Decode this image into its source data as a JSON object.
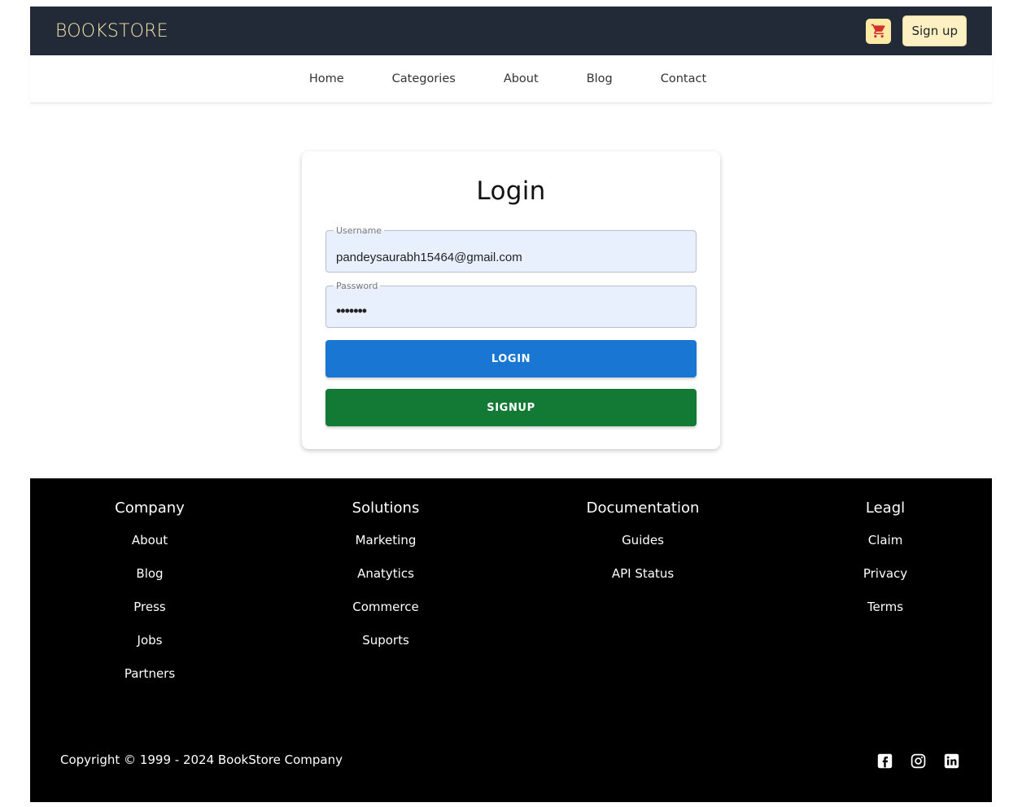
{
  "header": {
    "brand": "BOOKSTORE",
    "cart_icon": "cart-icon",
    "signup_label": "Sign up"
  },
  "nav": {
    "items": [
      "Home",
      "Categories",
      "About",
      "Blog",
      "Contact"
    ]
  },
  "login": {
    "title": "Login",
    "username_label": "Username",
    "username_value": "pandeysaurabh15464@gmail.com",
    "password_label": "Password",
    "password_value": "•••••••",
    "login_button": "LOGIN",
    "signup_button": "SIGNUP"
  },
  "footer": {
    "columns": [
      {
        "title": "Company",
        "links": [
          "About",
          "Blog",
          "Press",
          "Jobs",
          "Partners"
        ]
      },
      {
        "title": "Solutions",
        "links": [
          "Marketing",
          "Anatytics",
          "Commerce",
          "Suports"
        ]
      },
      {
        "title": "Documentation",
        "links": [
          "Guides",
          "API Status"
        ]
      },
      {
        "title": "Leagl",
        "links": [
          "Claim",
          "Privacy",
          "Terms"
        ]
      }
    ],
    "copyright": "Copyright © 1999 - 2024 BookStore Company",
    "socials": [
      "facebook-icon",
      "instagram-icon",
      "linkedin-icon"
    ]
  },
  "colors": {
    "header_bg": "#222a38",
    "brand": "#f5e6a8",
    "login_btn": "#1976d2",
    "signup_btn": "#137a36",
    "footer_bg": "#000000"
  }
}
